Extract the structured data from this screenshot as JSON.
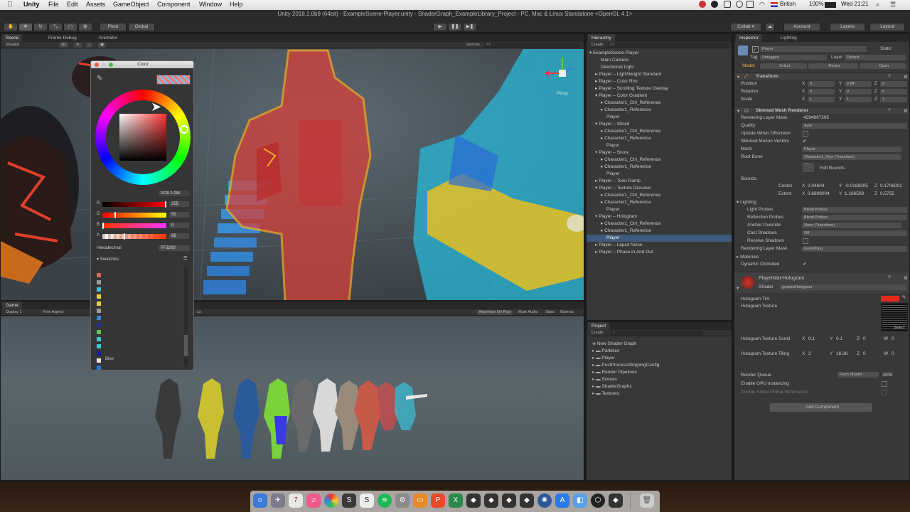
{
  "menubar": {
    "apple": "",
    "app": "Unity",
    "menus": [
      "File",
      "Edit",
      "Assets",
      "GameObject",
      "Component",
      "Window",
      "Help"
    ],
    "status": {
      "input": "British",
      "battery": "100%",
      "clock": "Wed 21:21"
    }
  },
  "window_title": "Unity 2018.1.0b9 (64bit) - ExampleScene-Player.unity - ShaderGraph_ExampleLibrary_Project - PC, Mac & Linux Standalone <OpenGL 4.1>",
  "toolbar": {
    "pivot": "Pivot",
    "global": "Global",
    "collab": "Collab ▾",
    "account": "Account",
    "layers": "Layers",
    "layout": "Layout"
  },
  "scene": {
    "tabs": [
      "Scene",
      "Frame Debug",
      "Animator"
    ],
    "shading": "Shaded",
    "mode2d": "2D",
    "gizmos": "Gizmos",
    "search": "All",
    "persp": "Persp"
  },
  "game": {
    "tab": "Game",
    "display": "Display 1",
    "aspect": "Free Aspect",
    "scale": "1x",
    "maximize": "Maximize On Play",
    "mute": "Mute Audio",
    "stats": "Stats",
    "gizmos": "Gizmos"
  },
  "color_picker": {
    "title": "Color",
    "mode": "RGB 0-255",
    "channels": [
      {
        "label": "R",
        "value": "255",
        "fill": 1.0
      },
      {
        "label": "G",
        "value": "50",
        "fill": 0.196
      },
      {
        "label": "B",
        "value": "0",
        "fill": 0.0
      },
      {
        "label": "A",
        "value": "86",
        "fill": 0.337
      }
    ],
    "hex_label": "Hexadecimal",
    "hex_value": "FF3200",
    "swatches_label": "Swatches",
    "swatch_colors": [
      "#d86a5a",
      "#9a9a9a",
      "#3fc4d8",
      "#e8d23a",
      "#e8d23a",
      "#9a9a9a",
      "#3f86d8",
      "#2a2a9a",
      "#5ac85a",
      "#3fc4d8",
      "#3fc4d8",
      "#1a1aa0",
      "#e8e8e8",
      "#1a7ad8",
      "#d83a2a"
    ],
    "hovered_swatch": "Blue",
    "current_color": "#ff3200"
  },
  "hierarchy": {
    "tab": "Hierarchy",
    "create": "Create",
    "search": "All",
    "rows": [
      {
        "text": "▾ ExampleScene-Player",
        "indent": 0
      },
      {
        "text": "Main Camera",
        "indent": 2
      },
      {
        "text": "Directional Light",
        "indent": 2
      },
      {
        "text": "▸ Player – LightWeight Standard",
        "indent": 1
      },
      {
        "text": "▸ Player – Color Rim",
        "indent": 1
      },
      {
        "text": "▸ Player – Scrolling Texture Overlay",
        "indent": 1
      },
      {
        "text": "▾ Player – Color Gradient",
        "indent": 1
      },
      {
        "text": "▸ Character1_Ctrl_Reference",
        "indent": 2
      },
      {
        "text": "▸ Character1_Reference",
        "indent": 2
      },
      {
        "text": "Player",
        "indent": 3
      },
      {
        "text": "▾ Player – Sliced",
        "indent": 1
      },
      {
        "text": "▸ Character1_Ctrl_Reference",
        "indent": 2
      },
      {
        "text": "▸ Character1_Reference",
        "indent": 2
      },
      {
        "text": "Player",
        "indent": 3
      },
      {
        "text": "▾ Player – Snow",
        "indent": 1
      },
      {
        "text": "▸ Character1_Ctrl_Reference",
        "indent": 2
      },
      {
        "text": "▸ Character1_Reference",
        "indent": 2
      },
      {
        "text": "Player",
        "indent": 3
      },
      {
        "text": "▸ Player – Toon Ramp",
        "indent": 1
      },
      {
        "text": "▾ Player – Texture Dissolve",
        "indent": 1
      },
      {
        "text": "▸ Character1_Ctrl_Reference",
        "indent": 2
      },
      {
        "text": "▸ Character1_Reference",
        "indent": 2
      },
      {
        "text": "Player",
        "indent": 3
      },
      {
        "text": "▾ Player – Hologram",
        "indent": 1
      },
      {
        "text": "▸ Character1_Ctrl_Reference",
        "indent": 2
      },
      {
        "text": "▸ Character1_Reference",
        "indent": 2
      },
      {
        "text": "Player",
        "indent": 3,
        "selected": true
      },
      {
        "text": "▸ Player – Liquid Noise",
        "indent": 1
      },
      {
        "text": "▸ Player – Phase In And Out",
        "indent": 1
      }
    ]
  },
  "project": {
    "tab": "Project",
    "create": "Create",
    "items": [
      "New Shader Graph",
      "Particles",
      "Player",
      "PostProcessStrippingConfig",
      "Render Pipelines",
      "Scenes",
      "ShaderGraphs",
      "Textures"
    ]
  },
  "inspector": {
    "tabs": [
      "Inspector",
      "Lighting"
    ],
    "object_name": "Player",
    "static_label": "Static",
    "tag_label": "Tag",
    "tag_value": "Untagged",
    "layer_label": "Layer",
    "layer_value": "Default",
    "model_label": "Model",
    "model_buttons": [
      "Select",
      "Revert",
      "Open"
    ],
    "transform": {
      "title": "Transform",
      "rows": [
        {
          "label": "Position",
          "x": "0",
          "y": "2.64",
          "z": "0"
        },
        {
          "label": "Rotation",
          "x": "0",
          "y": "0",
          "z": "0"
        },
        {
          "label": "Scale",
          "x": "1",
          "y": "1",
          "z": "1"
        }
      ]
    },
    "smr": {
      "title": "Skinned Mesh Renderer",
      "rendering_layer_mask_label": "Rendering Layer Mask",
      "rendering_layer_mask_value": "4294967295",
      "quality_label": "Quality",
      "quality_value": "Auto",
      "update_offscreen": "Update When Offscreen",
      "skinned_motion": "Skinned Motion Vectors",
      "mesh_label": "Mesh",
      "mesh_value": "Player",
      "root_bone_label": "Root Bone",
      "root_bone_value": "Character1_Hips (Transform)",
      "edit_bounds": "Edit Bounds",
      "bounds_label": "Bounds",
      "center_label": "Center",
      "center": {
        "x": "0.04604",
        "y": "-0.0169305",
        "z": "0.1706001"
      },
      "extent_label": "Extent",
      "extent": {
        "x": "0.6808004",
        "y": "1.166508",
        "z": "0.5755"
      },
      "lighting_label": "Lighting",
      "light_probes_label": "Light Probes",
      "light_probes_value": "Blend Probes",
      "reflection_probes_label": "Reflection Probes",
      "reflection_probes_value": "Blend Probes",
      "anchor_override_label": "Anchor Override",
      "anchor_override_value": "None (Transform)",
      "cast_shadows_label": "Cast Shadows",
      "cast_shadows_value": "Off",
      "receive_shadows_label": "Receive Shadows",
      "rlm2_label": "Rendering Layer Mask",
      "rlm2_value": "Everything",
      "materials_label": "Materials",
      "dynamic_occluded_label": "Dynamic Occluded"
    },
    "material": {
      "name": "PlayerMat-Hologram",
      "shader_label": "Shader",
      "shader_value": "graphs/Hologram",
      "hologram_tint": "Hologram Tint",
      "hologram_texture": "Hologram Texture",
      "select": "Select",
      "scroll_label": "Hologram Texture Scroll",
      "scroll": {
        "x": "0.1",
        "y": "0.1",
        "z": "0",
        "w": "0"
      },
      "tiling_label": "Hologram Texture Tiling",
      "tiling": {
        "x": "2",
        "y": "16.36",
        "z": "0",
        "w": "0"
      },
      "render_queue_label": "Render Queue",
      "render_queue_mode": "From Shader",
      "render_queue_value": "3000",
      "gpu_instancing": "Enable GPU Instancing",
      "double_sided_gi": "Double Sided Global Illumination"
    },
    "add_component": "Add Component"
  },
  "colors": {
    "accent_selection": "#3c5b7d",
    "hologram_tint": "#e8281a",
    "hologram_outline": "#f5a623"
  }
}
